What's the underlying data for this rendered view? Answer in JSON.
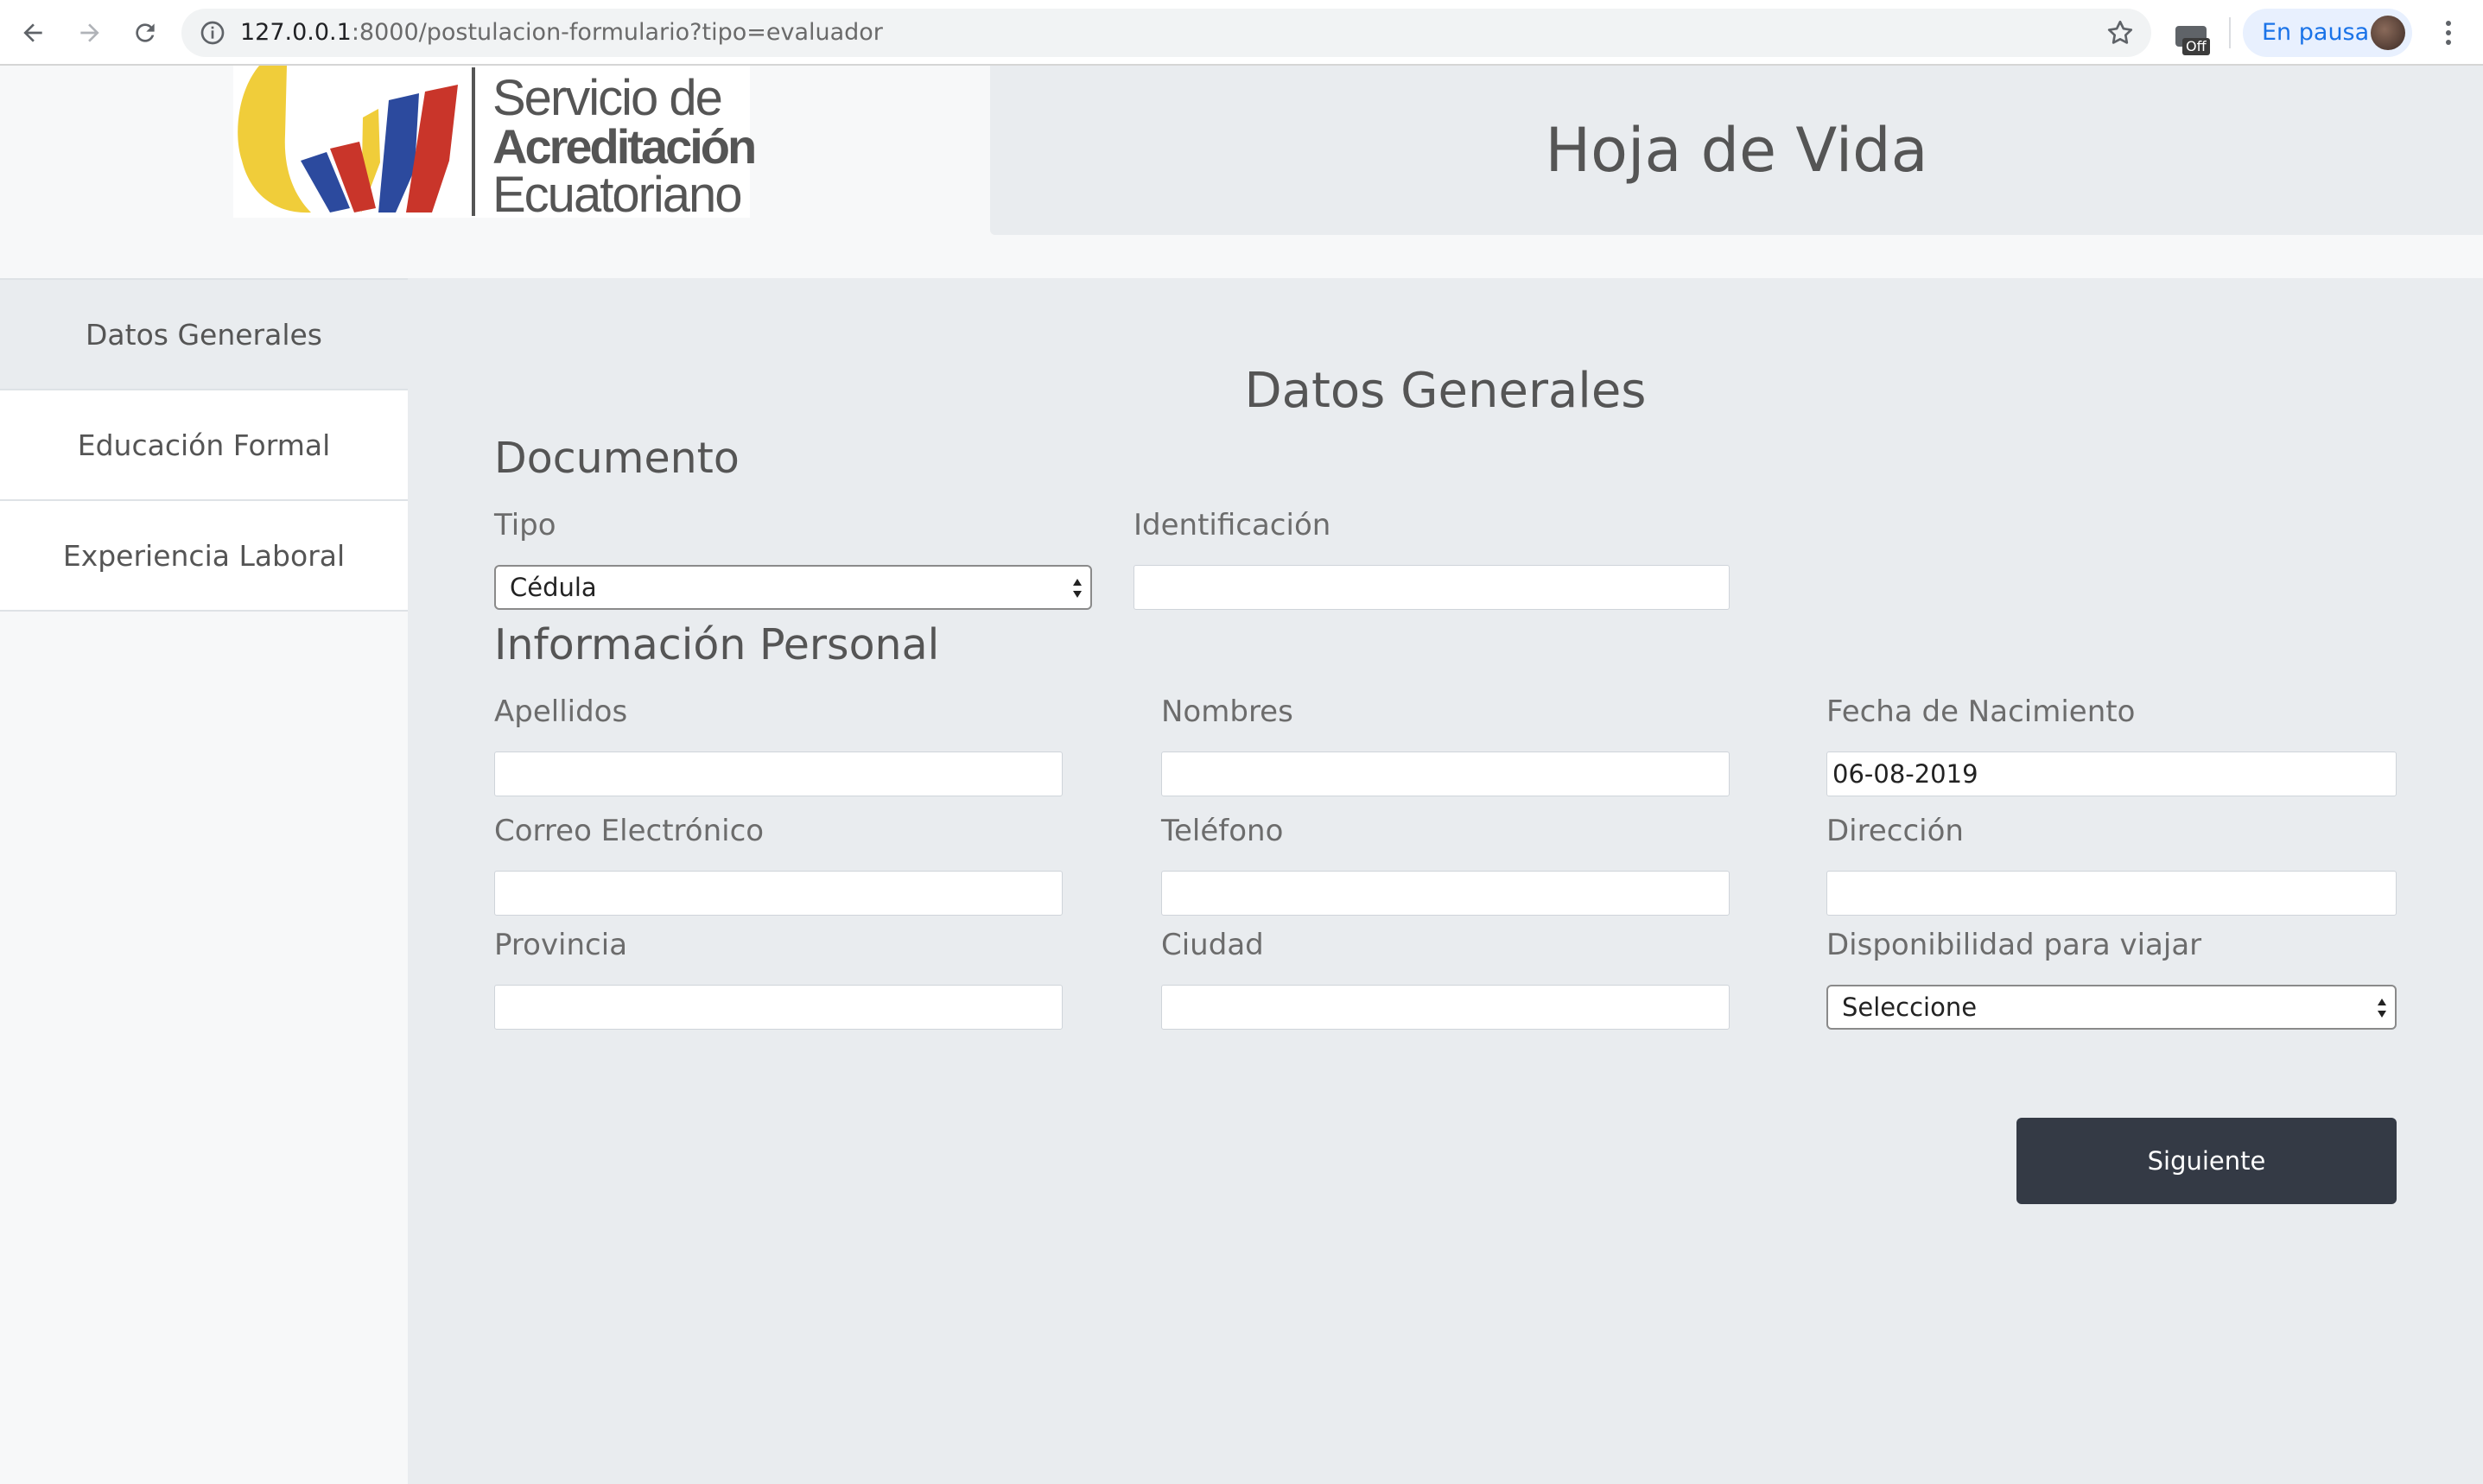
{
  "browser": {
    "url_host": "127.0.0.1",
    "url_path": ":8000/postulacion-formulario?tipo=evaluador",
    "extension_badge": "Off",
    "profile_label": "En pausa"
  },
  "header": {
    "logo_line1": "Servicio de",
    "logo_line2": "Acreditación",
    "logo_line3": "Ecuatoriano",
    "title": "Hoja de Vida"
  },
  "sidebar": {
    "items": [
      {
        "label": "Datos Generales",
        "active": true
      },
      {
        "label": "Educación Formal",
        "active": false
      },
      {
        "label": "Experiencia Laboral",
        "active": false
      }
    ]
  },
  "form": {
    "heading": "Datos Generales",
    "documento": {
      "title": "Documento",
      "tipo_label": "Tipo",
      "tipo_value": "Cédula",
      "identificacion_label": "Identificación",
      "identificacion_value": ""
    },
    "personal": {
      "title": "Información Personal",
      "apellidos_label": "Apellidos",
      "apellidos_value": "",
      "nombres_label": "Nombres",
      "nombres_value": "",
      "fecha_label": "Fecha de Nacimiento",
      "fecha_value": "06-08-2019",
      "correo_label": "Correo Electrónico",
      "correo_value": "",
      "telefono_label": "Teléfono",
      "telefono_value": "",
      "direccion_label": "Dirección",
      "direccion_value": "",
      "provincia_label": "Provincia",
      "provincia_value": "",
      "ciudad_label": "Ciudad",
      "ciudad_value": "",
      "viajar_label": "Disponibilidad para viajar",
      "viajar_value": "Seleccione"
    },
    "next_button": "Siguiente"
  },
  "colors": {
    "logo_yellow": "#f0cd3a",
    "logo_blue": "#2c4a9e",
    "logo_red": "#c9352a",
    "button_bg": "#343a45"
  }
}
